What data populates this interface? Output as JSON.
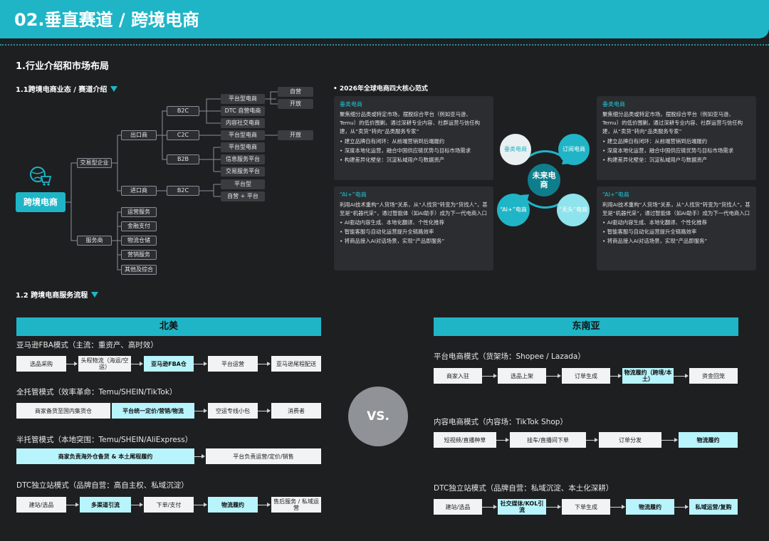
{
  "header": {
    "title": "02.垂直赛道 / 跨境电商"
  },
  "section1": {
    "title": "1.行业介绍和市场布局",
    "sub1": "1.1跨境电商业态 / 赛道介绍",
    "sub2": "1.2 跨境电商服务流程"
  },
  "tree": {
    "root": "跨境电商",
    "trade": "交易型企业",
    "service": "服务商",
    "export": "出口商",
    "import": "进口商",
    "b2c": "B2C",
    "c2c": "C2C",
    "b2b": "B2B",
    "b2c_import": "B2C",
    "platform_type": "平台型电商",
    "dtc": "DTC 自营电商",
    "content_social": "内容社交电商",
    "self_run": "自营",
    "open": "开放",
    "c2c_platform": "平台型电商",
    "c2c_open": "开放",
    "b2b_platform": "平台型电商",
    "b2b_info": "信息服务平台",
    "b2b_trade": "交易服务平台",
    "import_platform": "平台型",
    "import_mixed": "自营 + 平台",
    "services": [
      "运营服务",
      "金融支付",
      "物流仓储",
      "营销服务",
      "其他及综合"
    ]
  },
  "paradigm": {
    "title": "• 2026年全球电商四大核心范式",
    "cards": [
      {
        "title": "垂类电商",
        "desc": "聚焦细分品类或特定市场，摆脱综合平台（例如亚马逊、Temu）的低价围剿，通过深耕专业内容、社群运营与信任构建，从“卖货”转向“品类服务专家”",
        "bullets": [
          "• 建立品牌自有闭环：从前端营销到后端履约",
          "• 深度本地化运营，融合中国供应链优势与目标市场需求",
          "• 构建差异化壁垒：沉淀私域用户与数据资产"
        ]
      },
      {
        "title": "垂类电商",
        "desc": "聚焦细分品类或特定市场，摆脱综合平台（例如亚马逊、Temu）的低价围剿，通过深耕专业内容、社群运营与信任构建，从“卖货”转向“品类服务专家”",
        "bullets": [
          "• 建立品牌自有闭环：从前端营销到后端履约",
          "• 深度本地化运营，融合中国供应链优势与目标市场需求",
          "• 构建差异化壁垒：沉淀私域用户与数据资产"
        ]
      },
      {
        "title": "“AI+”电商",
        "desc": "利用AI技术重构“人货场”关系，从“人找货”转变为“货找人”，甚至是“机器代采”，通过智能体（如AI助手）成为下一代电商入口",
        "bullets": [
          "• AI驱动内容生成、本地化翻译、个性化推荐",
          "• 智能客服与自动化运营提升全链路效率",
          "• 将商品接入AI对话场景，实现“产品即服务”"
        ]
      },
      {
        "title": "“AI+”电商",
        "desc": "利用AI技术重构“人货场”关系，从“人找货”转变为“货找人”，甚至是“机器代采”，通过智能体（如AI助手）成为下一代电商入口",
        "bullets": [
          "• AI驱动内容生成、本地化翻译、个性化推荐",
          "• 智能客服与自动化运营提升全链路效率",
          "• 将商品接入AI对话场景，实现“产品即服务”"
        ]
      }
    ],
    "center": "未来电商",
    "c_vertical": "垂类电商",
    "c_subscribe": "订阅电商",
    "c_ai": "“AI+”电商",
    "c_headless": "“无头”电商"
  },
  "flows": {
    "na_title": "北美",
    "sea_title": "东南亚",
    "vs": "VS.",
    "na": [
      {
        "mode": "亚马逊FBA模式（主流：重资产、高时效）",
        "steps": [
          "选品采购",
          "头程物流（海运/空运）",
          "亚马逊FBA仓",
          "平台运营",
          "亚马逊尾程配送"
        ]
      },
      {
        "mode": "全托管模式（效率革命：Temu/SHEIN/TikTok）",
        "steps": [
          "商家备货至国内集货仓",
          "平台统一定价/营销/物流",
          "空运专线小包",
          "消费者"
        ]
      },
      {
        "mode": "半托管模式（本地突围：Temu/SHEIN/AliExpress）",
        "steps": [
          "商家负责海外仓备货 & 本土尾程履约",
          "平台负责运营/定价/销售"
        ]
      },
      {
        "mode": "DTC独立站模式（品牌自营：高自主权、私域沉淀）",
        "steps": [
          "建站/选品",
          "多渠道引流",
          "下单/支付",
          "物流履约",
          "售后服务 / 私域运营"
        ]
      }
    ],
    "sea": [
      {
        "mode": "平台电商模式（货架场：Shopee / Lazada）",
        "steps": [
          "商家入驻",
          "选品上架",
          "订单生成",
          "物流履约（跨境/本土）",
          "资金回笼"
        ]
      },
      {
        "mode": "内容电商模式（内容场：TikTok Shop）",
        "steps": [
          "短视频/直播种草",
          "挂车/直播间下单",
          "订单分发",
          "物流履约"
        ]
      },
      {
        "mode": "DTC独立站模式（品牌自营：私域沉淀、本土化深耕）",
        "steps": [
          "建站/选品",
          "社交媒体/KOL引流",
          "下单生成",
          "物流履约",
          "私域运营/复购"
        ]
      }
    ]
  }
}
